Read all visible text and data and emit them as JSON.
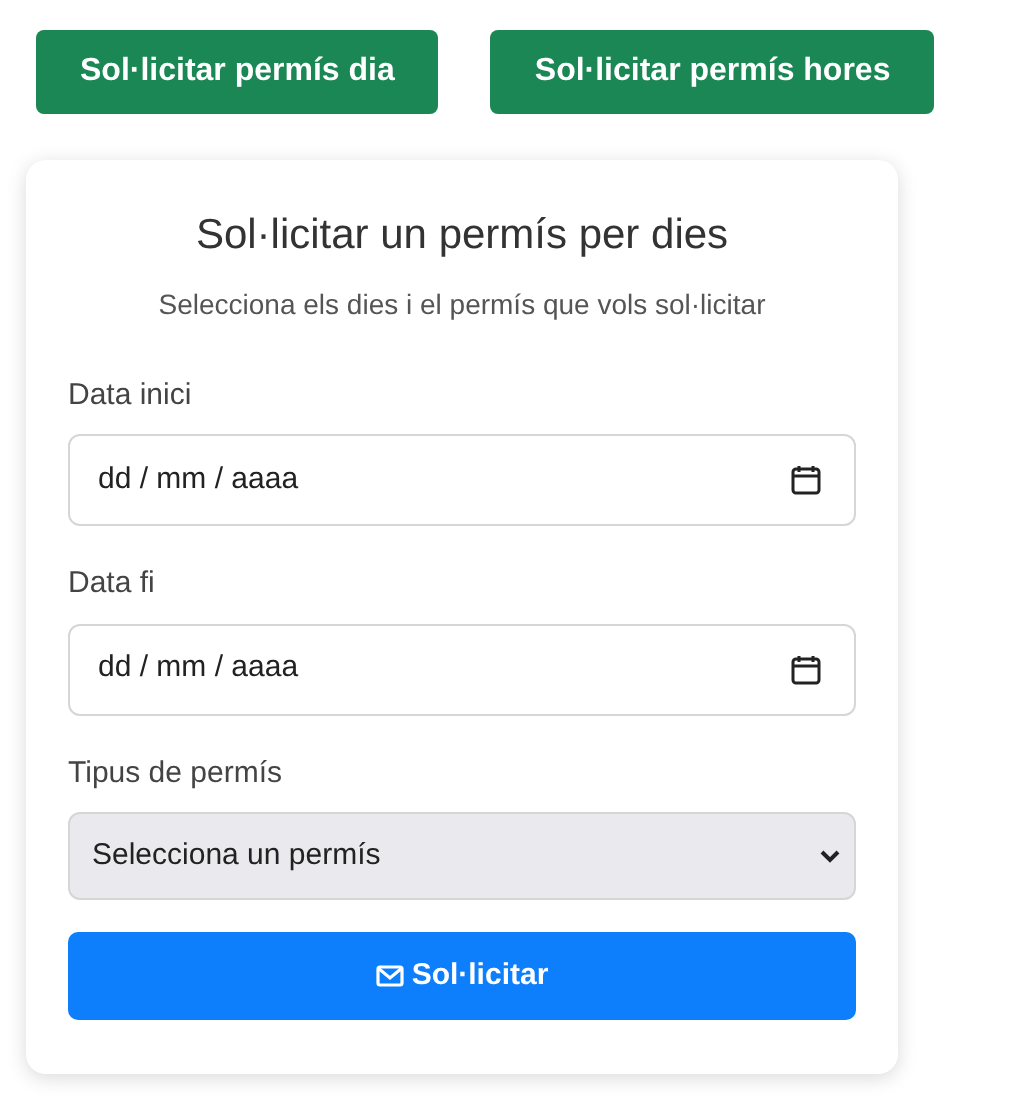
{
  "top_buttons": [
    {
      "label": "Sol·licitar permís dia"
    },
    {
      "label": "Sol·licitar permís hores"
    }
  ],
  "form": {
    "title": "Sol·licitar un permís per dies",
    "subtitle": "Selecciona els dies i el permís que vols sol·licitar",
    "fields": [
      {
        "kind": "date",
        "label": "Data inici",
        "value": "dd / mm / aaaa"
      },
      {
        "kind": "date",
        "label": "Data fi",
        "value": "dd / mm / aaaa"
      },
      {
        "kind": "select",
        "label": "Tipus de permís",
        "value": "Selecciona un permís"
      }
    ],
    "submit": "Sol·licitar"
  }
}
